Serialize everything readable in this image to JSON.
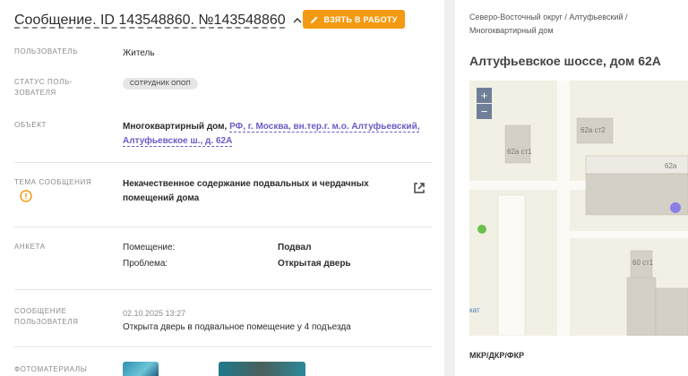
{
  "header": {
    "title": "Сообщение. ID 143548860. №143548860",
    "take_button": "Взять в работу"
  },
  "fields": {
    "user_label": "Пользователь",
    "user_value": "Житель",
    "status_label_1": "Статус поль-",
    "status_label_2": "зователя",
    "status_chip": "Сотрудник ОПОП",
    "object_label": "Объект",
    "object_prefix": "Многоквартирный дом,",
    "object_link_1": "РФ, г. Москва, вн.тер.г. м.о. Алтуфьевский,",
    "object_link_2": "Алтуфьевское ш., д. 62А",
    "topic_label": "Тема сообщения",
    "topic_line_1": "Некачественное содержание подвальных и чердачных",
    "topic_line_2": "помещений дома",
    "survey_label": "Анкета",
    "survey": [
      {
        "q": "Помещение:",
        "a": "Подвал"
      },
      {
        "q": "Проблема:",
        "a": "Открытая дверь"
      }
    ],
    "message_label_1": "Сообщение",
    "message_label_2": "пользователя",
    "message_date": "02.10.2025 13:27",
    "message_text": "Открыта дверь в подвальное помещение у 4 подъезда",
    "photos_label": "Фотоматериалы"
  },
  "right": {
    "breadcrumb_1": "Северо-Восточный округ / Алтуфьевский /",
    "breadcrumb_2": "Многоквартирный дом",
    "address": "Алтуфьевское шоссе, дом 62А",
    "map_labels": {
      "b1": "62а ст1",
      "b2": "62а ст2",
      "b3": "62а",
      "b4": "60 ст1",
      "poi": "кат"
    },
    "zoom_in": "+",
    "zoom_out": "−",
    "mkr_label": "МКР/ДКР/ФКР"
  },
  "colors": {
    "accent": "#f39a12",
    "link": "#6a5ac6",
    "warning": "#f39a12",
    "map_bg": "#f2efe4",
    "building": "#d4d0c6",
    "marker": "#8b7fe6"
  }
}
